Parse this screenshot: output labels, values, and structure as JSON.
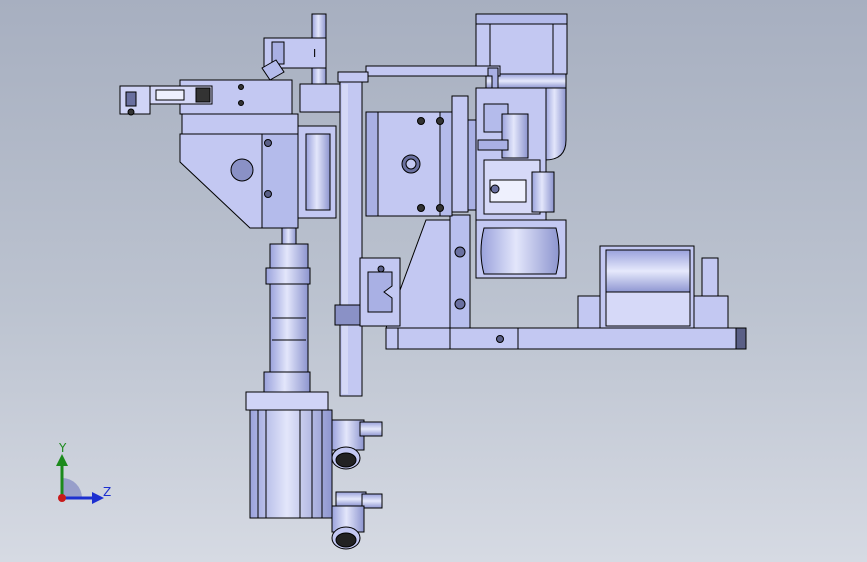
{
  "viewport": {
    "background_top": "#a7afc0",
    "background_bottom": "#d6dae3",
    "part_fill": "#c3c8f2",
    "part_shade": "#a9b0e4",
    "part_dark": "#5a5f86",
    "edge_color": "#000000"
  },
  "part_labels": {
    "bracket_mark": "I"
  },
  "triad": {
    "y_label": "Y",
    "z_label": "Z",
    "y_color": "#1c8a1c",
    "z_color": "#1c2fd0",
    "origin_color": "#c81a1a"
  }
}
